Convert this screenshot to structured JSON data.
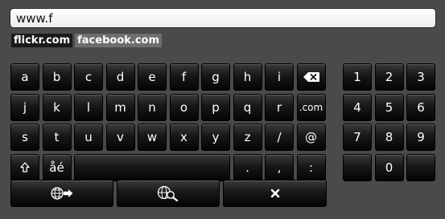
{
  "url_input": {
    "value": "www.f"
  },
  "suggestions": [
    {
      "label": "flickr.com",
      "active": true
    },
    {
      "label": "facebook.com",
      "active": false
    }
  ],
  "keyboard": {
    "rows": [
      [
        "a",
        "b",
        "c",
        "d",
        "e",
        "f",
        "g",
        "h",
        "i"
      ],
      [
        "j",
        "k",
        "l",
        "m",
        "n",
        "o",
        "p",
        "q",
        "r",
        ".com"
      ],
      [
        "s",
        "t",
        "u",
        "v",
        "w",
        "x",
        "y",
        "z",
        "/",
        "@"
      ],
      [
        ".",
        ",",
        ":"
      ]
    ],
    "accent_label": "åé",
    "shift_icon": "shift-arrow-icon",
    "backspace_icon": "backspace-icon"
  },
  "numpad": {
    "rows": [
      [
        "1",
        "2",
        "3"
      ],
      [
        "4",
        "5",
        "6"
      ],
      [
        "7",
        "8",
        "9"
      ],
      [
        "0"
      ]
    ]
  },
  "actions": [
    {
      "icon": "go-to-url-icon"
    },
    {
      "icon": "web-search-icon"
    },
    {
      "icon": "close-icon"
    }
  ]
}
